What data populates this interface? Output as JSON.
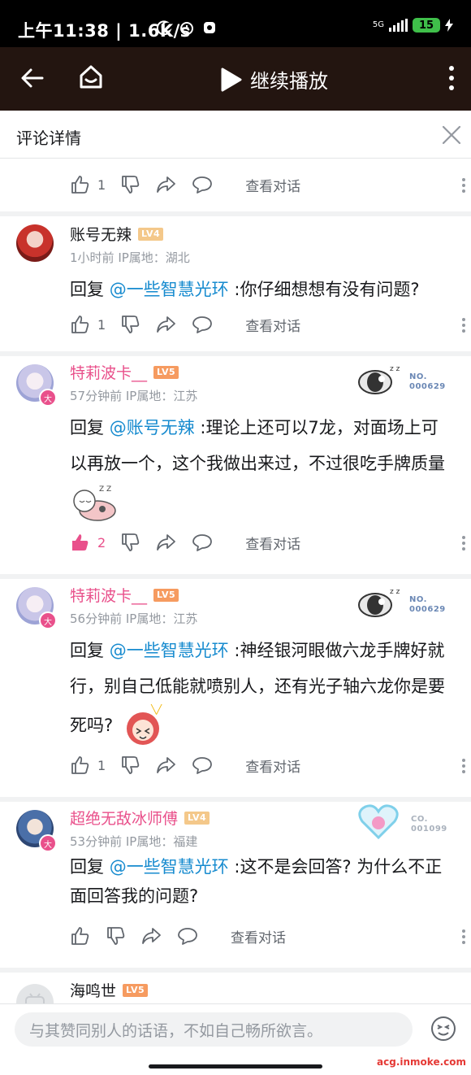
{
  "status_bar": {
    "time_speed": "上午11:38 | 1.6K/s",
    "network": "5G",
    "battery": "15"
  },
  "top_bar": {
    "continue_label": "继续播放"
  },
  "header": {
    "title": "评论详情"
  },
  "first_actions": {
    "like_count": "1",
    "view_conversation": "查看对话"
  },
  "comments": [
    {
      "username": "账号无辣",
      "level": "LV4",
      "level_color": "#f4c88a",
      "time": "1小时前",
      "ip": "IP属地：湖北",
      "reply_prefix": "回复 ",
      "mention": "@一些智慧光环",
      "text": " :你仔细想想有没有问题?",
      "like_count": "1",
      "view_conversation": "查看对话"
    },
    {
      "username": "特莉波卡__",
      "level": "LV5",
      "level_color": "#f69b60",
      "time": "57分钟前",
      "ip": "IP属地：江苏",
      "badge_no_label": "NO.",
      "badge_no": "000629",
      "reply_prefix": "回复 ",
      "mention": "@账号无辣",
      "text": " :理论上还可以7龙，对面场上可以再放一个，这个我做出来过，不过很吃手牌质量",
      "like_count": "2",
      "view_conversation": "查看对话"
    },
    {
      "username": "特莉波卡__",
      "level": "LV5",
      "level_color": "#f69b60",
      "time": "56分钟前",
      "ip": "IP属地：江苏",
      "badge_no_label": "NO.",
      "badge_no": "000629",
      "reply_prefix": "回复 ",
      "mention": "@一些智慧光环",
      "text": " :神经银河眼做六龙手牌好就行，别自己低能就喷别人，还有光子轴六龙你是要死吗?",
      "like_count": "1",
      "view_conversation": "查看对话"
    },
    {
      "username": "超绝无敌冰师傅",
      "level": "LV4",
      "level_color": "#f4c88a",
      "time": "53分钟前",
      "ip": "IP属地：福建",
      "badge_no_label": "CO.",
      "badge_no": "001099",
      "reply_prefix": "回复 ",
      "mention": "@一些智慧光环",
      "text": " :这不是会回答? 为什么不正面回答我的问题?",
      "view_conversation": "查看对话"
    },
    {
      "username": "海鸣世",
      "level": "LV5",
      "level_color": "#f69b60"
    }
  ],
  "bottom_bar": {
    "input_placeholder": "与其赞同别人的话语，不如自己畅所欲言。"
  },
  "watermark": "acg.inmoke.com",
  "colors": {
    "accent_pink": "#e9508b",
    "mention_blue": "#178bcf",
    "top_bar_bg": "#231510"
  }
}
